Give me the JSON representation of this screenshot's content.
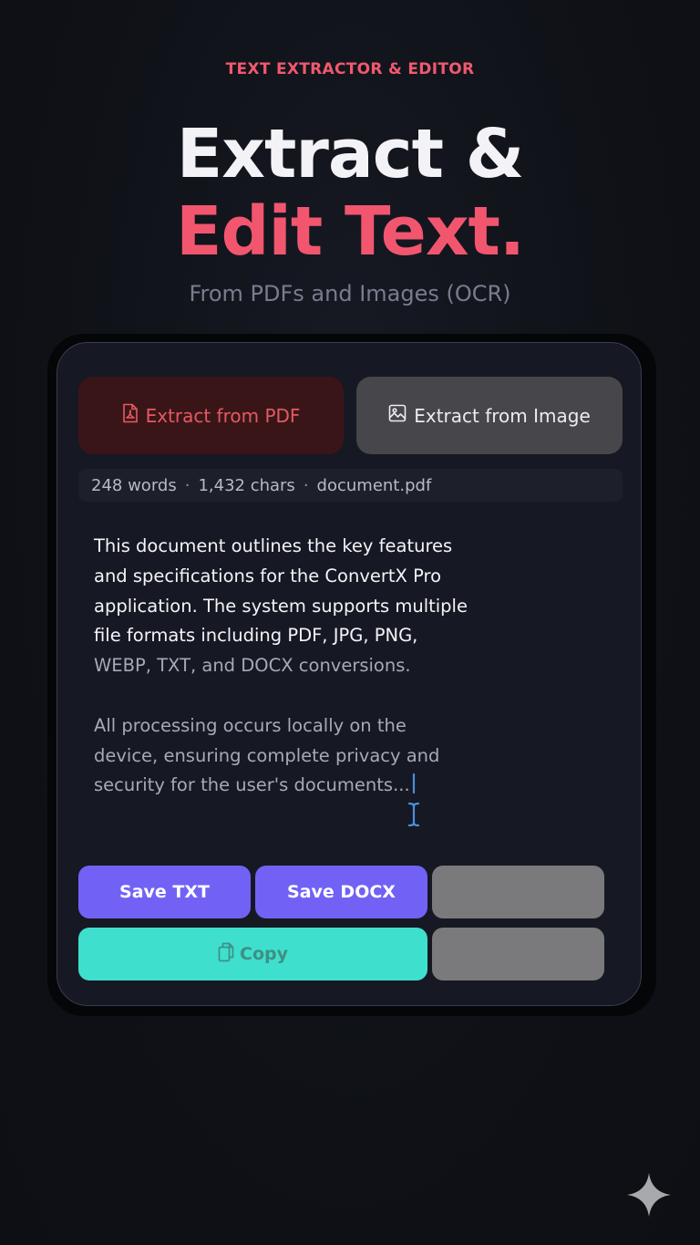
{
  "header": {
    "eyebrow": "TEXT EXTRACTOR & EDITOR",
    "title_line1": "Extract &",
    "title_line2": "Edit Text.",
    "subtitle": "From PDFs and Images (OCR)"
  },
  "tabs": [
    {
      "label": "Extract from PDF",
      "icon": "pdf-file-icon",
      "active": true
    },
    {
      "label": "Extract from Image",
      "icon": "image-icon",
      "active": false
    }
  ],
  "stats": {
    "words": "248 words",
    "chars": "1,432 chars",
    "file": "document.pdf",
    "separator": "·"
  },
  "editor": {
    "paragraph1": [
      "This document outlines the key features",
      "and specifications for the ConvertX Pro",
      "application. The system supports multiple",
      "file formats including PDF, JPG, PNG,",
      "WEBP, TXT, and DOCX conversions."
    ],
    "paragraph2": [
      "All processing occurs locally on the",
      "device, ensuring complete privacy and",
      "security for the user's documents..."
    ]
  },
  "actions": {
    "save_txt": "Save TXT",
    "save_docx": "Save DOCX",
    "copy": "Copy"
  },
  "colors": {
    "accent_pink": "#f2566f",
    "accent_purple": "#7162f5",
    "accent_teal": "#3ee0cd",
    "background": "#0f1117",
    "card": "#161823"
  },
  "icons": {
    "cursor": "text-cursor-icon",
    "copy": "copy-icon",
    "corner": "sparkle-icon"
  }
}
